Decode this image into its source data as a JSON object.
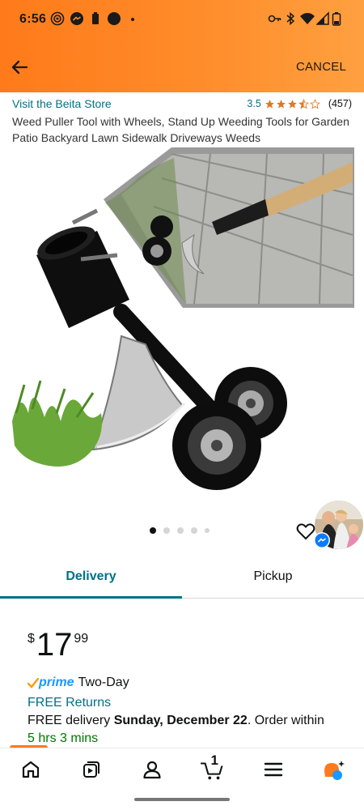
{
  "status_bar": {
    "time": "6:56"
  },
  "header": {
    "cancel_label": "CANCEL"
  },
  "product": {
    "store_link": "Visit the Beita Store",
    "rating_value": "3.5",
    "rating_count": "(457)",
    "title": "Weed Puller Tool with Wheels, Stand Up Weeding Tools for Garden Patio Backyard Lawn Sidewalk Driveways Weeds",
    "image_count": 5,
    "active_image_index": 0
  },
  "tabs": [
    {
      "label": "Delivery",
      "selected": true
    },
    {
      "label": "Pickup",
      "selected": false
    }
  ],
  "price": {
    "currency": "$",
    "whole": "17",
    "fraction": "99"
  },
  "shipping": {
    "prime_label": "prime",
    "prime_speed": "Two-Day",
    "free_returns": "FREE Returns",
    "delivery_prefix": "FREE delivery ",
    "delivery_date": "Sunday, December 22",
    "delivery_suffix": ". Order within",
    "order_within": "5 hrs 3 mins"
  },
  "bottom_nav": {
    "cart_count": "1",
    "items": [
      "home-icon",
      "video-icon",
      "account-icon",
      "cart-icon",
      "menu-icon",
      "rufus-icon"
    ]
  },
  "colors": {
    "header_orange": "#ff7a1a",
    "link_teal": "#007185",
    "prime_blue": "#1a98ff",
    "star_orange": "#de7921",
    "urgency_green": "#007600"
  }
}
